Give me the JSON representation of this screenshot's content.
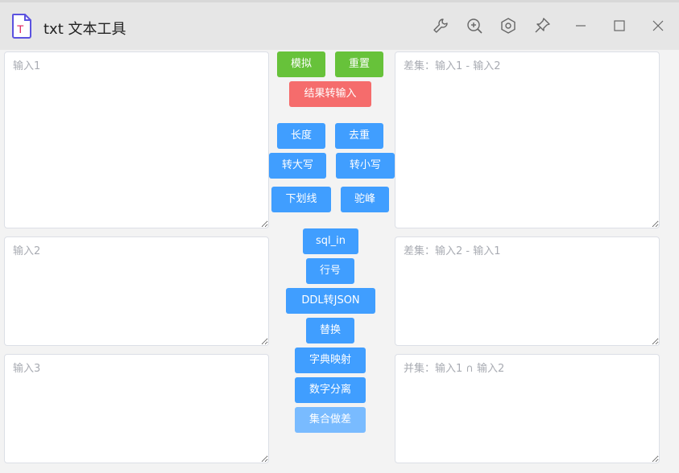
{
  "window": {
    "title": "txt 文本工具",
    "app_icon_letter": "T"
  },
  "inputs": {
    "input1": {
      "placeholder": "输入1",
      "value": ""
    },
    "input2": {
      "placeholder": "输入2",
      "value": ""
    },
    "input3": {
      "placeholder": "输入3",
      "value": ""
    }
  },
  "outputs": {
    "diff12": {
      "placeholder": "差集：输入1 - 输入2",
      "value": ""
    },
    "diff21": {
      "placeholder": "差集：输入2 - 输入1",
      "value": ""
    },
    "intersect": {
      "placeholder": "并集：输入1 ∩ 输入2",
      "value": ""
    }
  },
  "buttons": {
    "mock": "模拟",
    "reset": "重置",
    "result_to_input": "结果转输入",
    "length": "长度",
    "dedupe": "去重",
    "upper": "转大写",
    "lower": "转小写",
    "underline": "下划线",
    "camel": "驼峰",
    "sql_in": "sql_in",
    "line_no": "行号",
    "ddl_json": "DDL转JSON",
    "replace": "替换",
    "dict_map": "字典映射",
    "num_sep": "数字分离",
    "set_diff": "集合做差"
  },
  "colors": {
    "green": "#67c23a",
    "red": "#f56c6c",
    "blue": "#409eff",
    "light_blue": "#79bbff"
  }
}
